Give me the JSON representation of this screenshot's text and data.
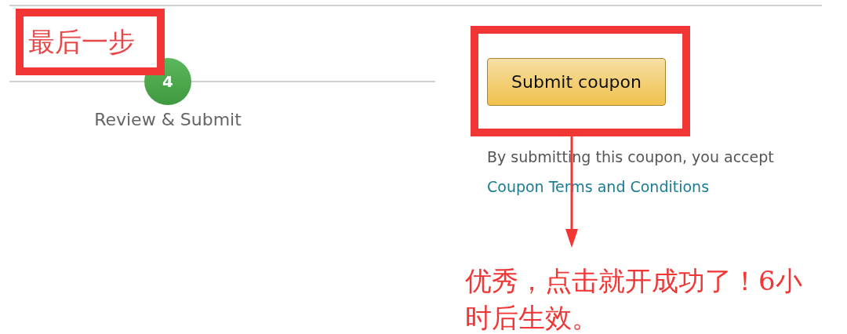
{
  "annotations": {
    "step_label": "最后一步",
    "note": "优秀，点击就开成功了！6小时后生效。"
  },
  "step": {
    "number": "4",
    "label": "Review & Submit"
  },
  "submit": {
    "button": "Submit coupon",
    "notice": "By submitting this coupon, you accept",
    "link": "Coupon Terms and Conditions"
  }
}
